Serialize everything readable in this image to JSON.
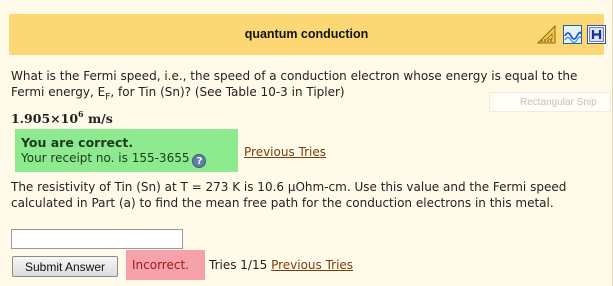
{
  "header": {
    "title": "quantum conduction",
    "icons": [
      "triangle-ruler-icon",
      "wave-icon",
      "hint-h-icon"
    ]
  },
  "question": {
    "text_before_sub": "What is the Fermi speed, i.e., the speed of a conduction electron whose energy is equal to the Fermi energy, E",
    "subscript": "F",
    "text_after_sub": ", for Tin (Sn)? (See Table 10-3 in Tipler)"
  },
  "snip_label": "Rectangular Snip",
  "answer": {
    "mantissa": "1.905×10",
    "exponent": "6",
    "unit": " m/s"
  },
  "feedback_correct": {
    "title": "You are correct.",
    "receipt_text": "Your receipt no. is 155-3655",
    "help_glyph": "?"
  },
  "previous_tries_1": "Previous Tries",
  "part2_text": "The resistivity of Tin (Sn) at T = 273 K is 10.6 μOhm-cm. Use this value and the Fermi speed calculated in Part (a) to find the mean free path for the conduction electrons in this metal.",
  "input": {
    "value": ""
  },
  "submit_label": "Submit Answer",
  "feedback_incorrect": "Incorrect.",
  "tries_text": "Tries 1/15",
  "previous_tries_2": "Previous Tries"
}
